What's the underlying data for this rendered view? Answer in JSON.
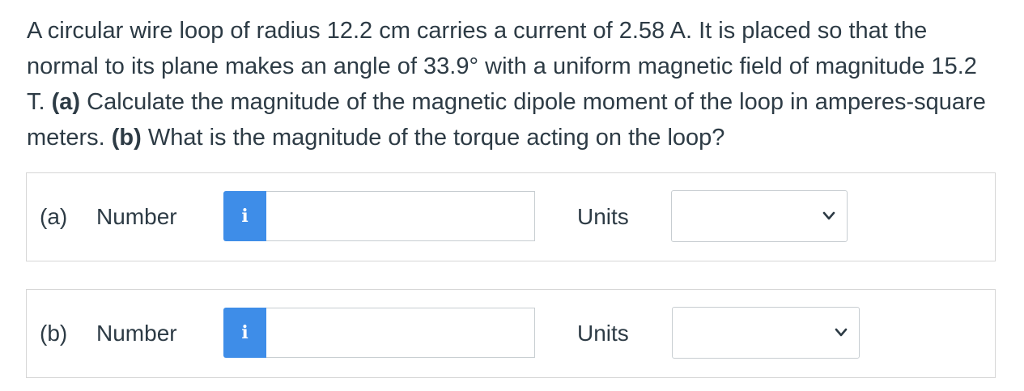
{
  "question": {
    "text_1": "A circular wire loop of radius 12.2 cm carries a current of 2.58 A. It is placed so that the normal to its plane makes an angle of 33.9° with a uniform magnetic field of magnitude 15.2 T. ",
    "part_a_tag": "(a)",
    "text_2": " Calculate the magnitude of the magnetic dipole moment of the loop in amperes-square meters. ",
    "part_b_tag": "(b)",
    "text_3": " What is the magnitude of the torque acting on the loop?"
  },
  "answers": {
    "a": {
      "part_label": "(a)",
      "number_label": "Number",
      "info_icon": "i",
      "number_value": "",
      "units_label": "Units",
      "units_selected": ""
    },
    "b": {
      "part_label": "(b)",
      "number_label": "Number",
      "info_icon": "i",
      "number_value": "",
      "units_label": "Units",
      "units_selected": ""
    }
  },
  "colors": {
    "text": "#2d3b45",
    "info_button": "#3e8de8",
    "border": "#d6d6d6"
  },
  "icons": {
    "info": "info-icon",
    "dropdown": "chevron-down-icon"
  }
}
